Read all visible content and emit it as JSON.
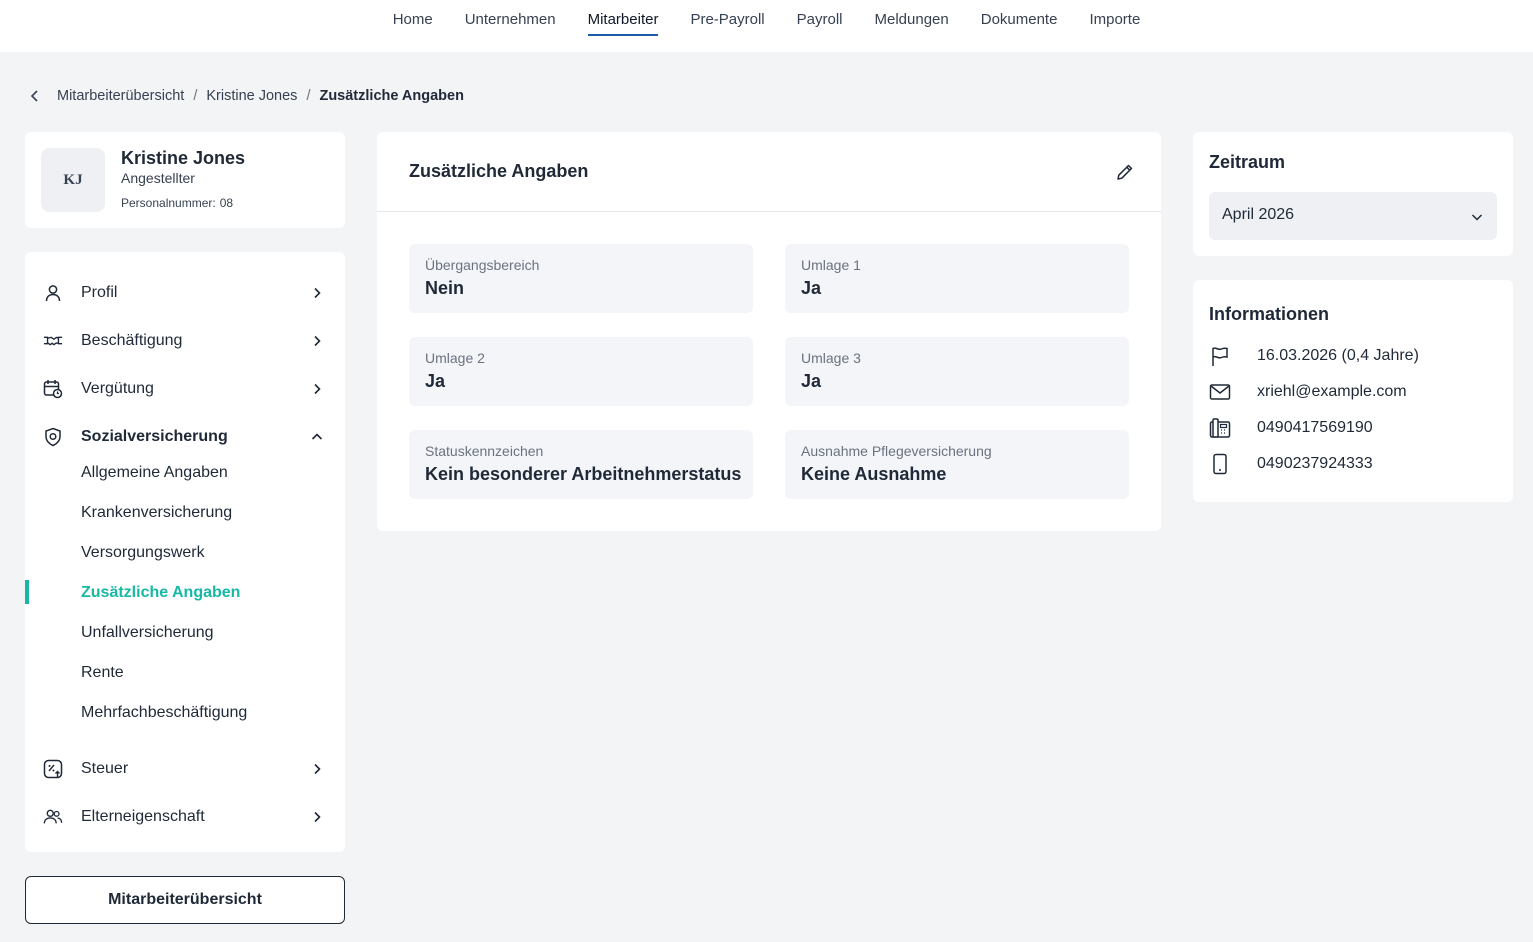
{
  "topnav": {
    "items": [
      "Home",
      "Unternehmen",
      "Mitarbeiter",
      "Pre-Payroll",
      "Payroll",
      "Meldungen",
      "Dokumente",
      "Importe"
    ],
    "active_index": 2
  },
  "breadcrumb": {
    "items": [
      "Mitarbeiterübersicht",
      "Kristine Jones"
    ],
    "current": "Zusätzliche Angaben"
  },
  "profile": {
    "initials": "KJ",
    "name": "Kristine Jones",
    "role": "Angestellter",
    "personalnummer_label": "Personalnummer:",
    "personalnummer": "08"
  },
  "menu": {
    "items": [
      {
        "label": "Profil",
        "icon": "user-icon"
      },
      {
        "label": "Beschäftigung",
        "icon": "handshake-icon"
      },
      {
        "label": "Vergütung",
        "icon": "calendar-clock-icon"
      },
      {
        "label": "Sozialversicherung",
        "icon": "shield-icon"
      },
      {
        "label": "Steuer",
        "icon": "tax-icon"
      },
      {
        "label": "Elterneigenschaft",
        "icon": "users-icon"
      }
    ],
    "sub_items": [
      "Allgemeine Angaben",
      "Krankenversicherung",
      "Versorgungswerk",
      "Zusätzliche Angaben",
      "Unfallversicherung",
      "Rente",
      "Mehrfachbeschäftigung"
    ],
    "active_sub_index": 3
  },
  "overview_button": "Mitarbeiterübersicht",
  "main": {
    "title": "Zusätzliche Angaben",
    "fields": [
      {
        "label": "Übergangsbereich",
        "value": "Nein"
      },
      {
        "label": "Umlage 1",
        "value": "Ja"
      },
      {
        "label": "Umlage 2",
        "value": "Ja"
      },
      {
        "label": "Umlage 3",
        "value": "Ja"
      },
      {
        "label": "Statuskennzeichen",
        "value": "Kein besonderer Arbeitnehmerstatus"
      },
      {
        "label": "Ausnahme Pflegeversicherung",
        "value": "Keine Ausnahme"
      }
    ]
  },
  "zeitraum": {
    "title": "Zeitraum",
    "selected": "April 2026"
  },
  "informationen": {
    "title": "Informationen",
    "rows": [
      {
        "icon": "flag-icon",
        "text": "16.03.2026 (0,4 Jahre)"
      },
      {
        "icon": "mail-icon",
        "text": "xriehl@example.com"
      },
      {
        "icon": "phone-icon",
        "text": "0490417569190"
      },
      {
        "icon": "mobile-icon",
        "text": "0490237924333"
      }
    ]
  },
  "colors": {
    "accent": "#17b8a6",
    "nav_underline": "#1e5aa8",
    "background": "#f3f4f6",
    "field_bg": "#f3f5f8"
  }
}
